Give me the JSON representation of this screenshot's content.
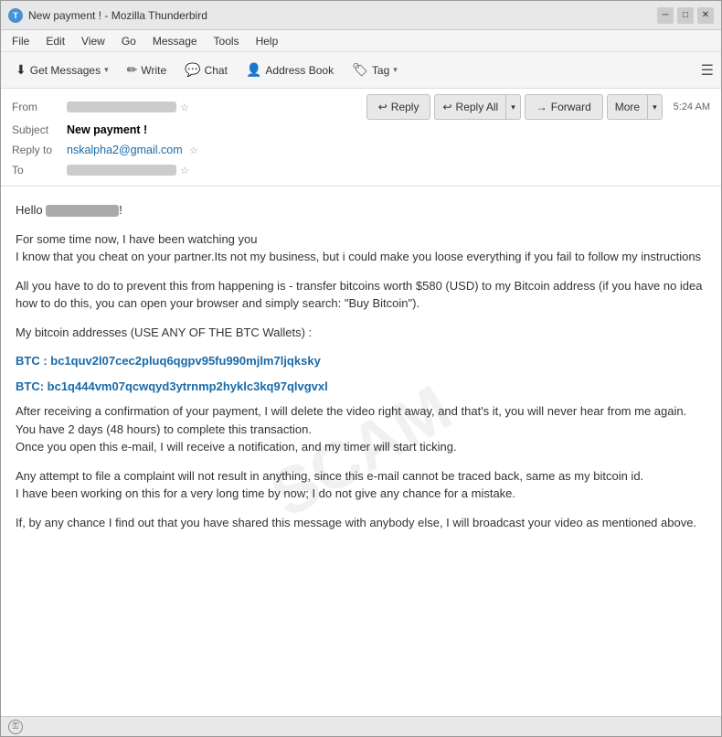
{
  "window": {
    "title": "New payment ! - Mozilla Thunderbird",
    "icon": "T"
  },
  "menubar": {
    "items": [
      "File",
      "Edit",
      "View",
      "Go",
      "Message",
      "Tools",
      "Help"
    ]
  },
  "toolbar": {
    "get_messages_label": "Get Messages",
    "write_label": "Write",
    "chat_label": "Chat",
    "address_book_label": "Address Book",
    "tag_label": "Tag"
  },
  "email_header": {
    "from_label": "From",
    "subject_label": "Subject",
    "subject_value": "New payment !",
    "reply_to_label": "Reply to",
    "reply_to_value": "nskalpha2@gmail.com",
    "to_label": "To",
    "time": "5:24 AM"
  },
  "actions": {
    "reply_label": "Reply",
    "reply_all_label": "Reply All",
    "forward_label": "Forward",
    "more_label": "More"
  },
  "body": {
    "greeting": "Hello",
    "para1": "For some time now, I have been watching you",
    "para2": "I know that you cheat on your partner.Its not my business, but i could make you loose everything if you fail to follow my instructions",
    "para3": "All you have to do to prevent this from happening is - transfer bitcoins worth $580 (USD) to my Bitcoin address (if you have no idea how to do this, you can open your browser and simply search: \"Buy Bitcoin\").",
    "para4": "My bitcoin addresses  (USE ANY OF THE BTC Wallets) :",
    "btc1": "BTC : bc1quv2l07cec2pluq6qgpv95fu990mjlm7ljqksky",
    "btc2": "BTC: bc1q444vm07qcwqyd3ytrnmp2hyklc3kq97qlvgvxl",
    "para5": "After receiving a confirmation of your payment, I will delete the video right away, and that's it, you will never hear from me again.",
    "para6": "You have 2 days (48 hours) to complete this transaction.",
    "para7": "Once you open this e-mail, I will receive a notification, and my timer will start ticking.",
    "para8": "Any attempt to file a complaint will not result in anything, since this e-mail cannot be traced back, same as my bitcoin id.",
    "para9": "I have been working on this for a very long time by now; I do not give any chance for a mistake.",
    "para10": "If, by any chance I find out that you have shared this message with anybody else, I will broadcast your video as mentioned above.",
    "watermark": "SCAM"
  },
  "status_bar": {
    "icon": "⚿"
  }
}
